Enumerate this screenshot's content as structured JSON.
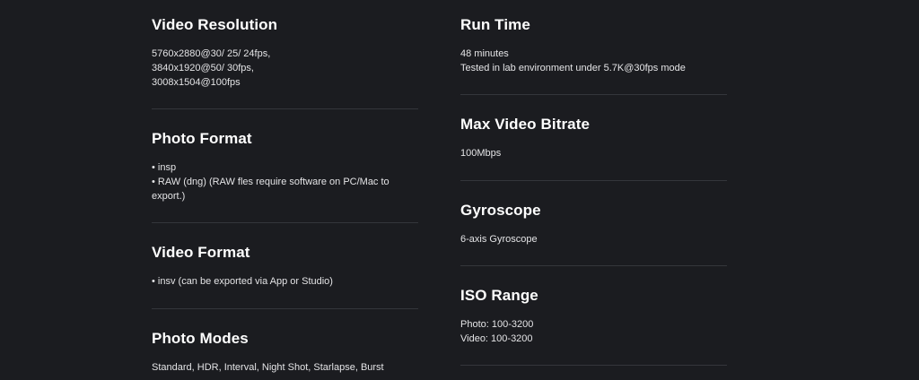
{
  "left_column": [
    {
      "title": "Video Resolution",
      "lines": [
        "5760x2880@30/ 25/ 24fps,",
        "3840x1920@50/ 30fps,",
        "3008x1504@100fps"
      ]
    },
    {
      "title": "Photo Format",
      "lines": [
        "• insp",
        "• RAW (dng) (RAW fles require software on PC/Mac to",
        "export.)"
      ]
    },
    {
      "title": "Video Format",
      "lines": [
        "• insv (can be exported via App or Studio)"
      ]
    },
    {
      "title": "Photo Modes",
      "lines": [
        "Standard, HDR, Interval, Night Shot, Starlapse, Burst"
      ]
    }
  ],
  "right_column": [
    {
      "title": "Run Time",
      "lines": [
        "48 minutes",
        "Tested in lab environment under 5.7K@30fps mode"
      ]
    },
    {
      "title": "Max Video Bitrate",
      "lines": [
        "100Mbps"
      ]
    },
    {
      "title": "Gyroscope",
      "lines": [
        "6-axis Gyroscope"
      ]
    },
    {
      "title": "ISO Range",
      "lines": [
        "Photo: 100-3200",
        "Video: 100-3200"
      ]
    }
  ],
  "colors": {
    "background": "#1b1c20",
    "text": "#ffffff",
    "divider": "#34363b"
  }
}
